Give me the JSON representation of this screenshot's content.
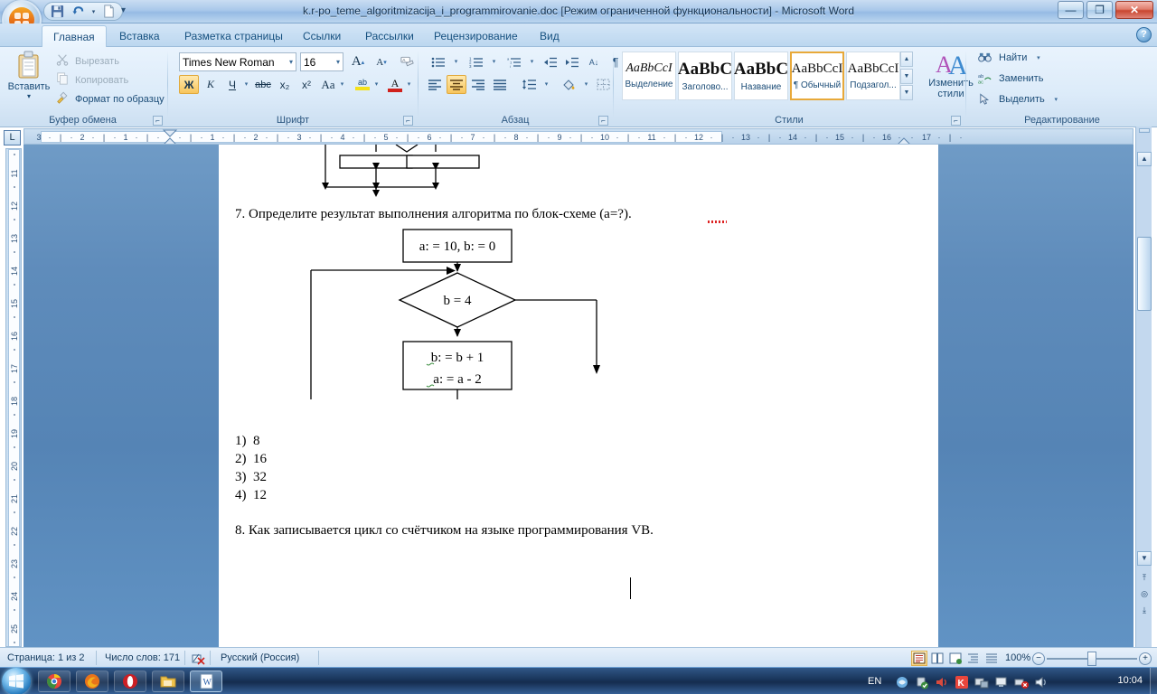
{
  "window": {
    "title": "k.r-po_teme_algoritmizacija_i_programmirovanie.doc [Режим ограниченной функциональности] - Microsoft Word",
    "minimize_label": "—",
    "maximize_label": "❐",
    "close_label": "✕"
  },
  "quick_access": {
    "save_label": "Сохранить",
    "undo_label": "Отменить",
    "undo_dropdown_label": "▾",
    "new_label": "Создать",
    "customize_label": "▾"
  },
  "tabs": [
    {
      "label": "Главная",
      "active": true
    },
    {
      "label": "Вставка",
      "active": false
    },
    {
      "label": "Разметка страницы",
      "active": false
    },
    {
      "label": "Ссылки",
      "active": false
    },
    {
      "label": "Рассылки",
      "active": false
    },
    {
      "label": "Рецензирование",
      "active": false
    },
    {
      "label": "Вид",
      "active": false
    }
  ],
  "help_label": "?",
  "ribbon": {
    "clipboard": {
      "group_label": "Буфер обмена",
      "paste_label": "Вставить",
      "paste_arrow": "▾",
      "cut_label": "Вырезать",
      "copy_label": "Копировать",
      "format_painter_label": "Формат по образцу",
      "launcher_label": "⌐"
    },
    "font": {
      "group_label": "Шрифт",
      "font_name": "Times New Roman",
      "font_size": "16",
      "grow_label": "A",
      "shrink_label": "A",
      "clear_format_label": "Aa",
      "bold_label": "Ж",
      "italic_label": "К",
      "underline_label": "Ч",
      "underline_arrow": "▾",
      "strike_label": "abc",
      "subscript_label": "x₂",
      "superscript_label": "x²",
      "case_label": "Aa",
      "case_arrow": "▾",
      "highlight_label": "ab",
      "highlight_arrow": "▾",
      "fontcolor_label": "A",
      "fontcolor_arrow": "▾",
      "launcher_label": "⌐"
    },
    "paragraph": {
      "group_label": "Абзац",
      "bullets_label": "☰",
      "numbering_label": "☰",
      "multilevel_label": "☰",
      "decrease_indent_label": "⇤",
      "increase_indent_label": "⇥",
      "sort_label": "A↓",
      "marks_label": "¶",
      "align_left_label": "☰",
      "align_center_label": "☰",
      "align_right_label": "☰",
      "justify_label": "☰",
      "linespacing_label": "↕",
      "shading_label": "▨",
      "borders_label": "▢",
      "launcher_label": "⌐"
    },
    "styles": {
      "group_label": "Стили",
      "items": [
        {
          "sample": "AaBbCcI",
          "name": "Выделение",
          "style": "italic-serif",
          "selected": false
        },
        {
          "sample": "AaBbC",
          "name": "Заголово...",
          "style": "bold-serif",
          "selected": false
        },
        {
          "sample": "AaBbC",
          "name": "Название",
          "style": "bold-serif",
          "selected": false
        },
        {
          "sample": "AaBbCcI",
          "name": "¶ Обычный",
          "style": "plain-serif",
          "selected": true
        },
        {
          "sample": "AaBbCcI",
          "name": "Подзагол...",
          "style": "plain-serif",
          "selected": false
        }
      ],
      "scroll_up_label": "▲",
      "scroll_down_label": "▼",
      "more_label": "▼",
      "change_styles_label_line1": "Изменить",
      "change_styles_label_line2": "стили",
      "change_styles_arrow": "▾",
      "launcher_label": "⌐"
    },
    "editing": {
      "group_label": "Редактирование",
      "find_label": "Найти",
      "find_arrow": "▾",
      "replace_label": "Заменить",
      "select_label": "Выделить",
      "select_arrow": "▾"
    }
  },
  "rulers": {
    "tab_stop_label": "L",
    "horizontal_numbers": [
      "3",
      "2",
      "1",
      "1",
      "2",
      "3",
      "4",
      "5",
      "6",
      "7",
      "8",
      "9",
      "10",
      "11",
      "12",
      "13",
      "14",
      "15",
      "16",
      "17"
    ],
    "vertical_numbers": [
      "11",
      "12",
      "13",
      "14",
      "15",
      "16",
      "17",
      "18",
      "19",
      "20",
      "21",
      "22",
      "23",
      "24",
      "25"
    ]
  },
  "document": {
    "question_7": "7. Определите результат выполнения алгоритма по блок-схеме (a=?).",
    "question_7_spell_word": "a=",
    "flowchart": {
      "init_box": "a: = 10, b: = 0",
      "decision": "b = 4",
      "process_line1": "b: = b + 1",
      "process_line2": "a: = a - 2"
    },
    "answers": [
      {
        "num": "1)",
        "value": "8"
      },
      {
        "num": "2)",
        "value": "16"
      },
      {
        "num": "3)",
        "value": "32"
      },
      {
        "num": "4)",
        "value": "12"
      }
    ],
    "question_8": "8. Как записывается цикл со счётчиком на языке программирования VB."
  },
  "status_bar": {
    "page_label": "Страница: 1 из 2",
    "words_label": "Число слов: 171",
    "proofing_icon": "spellcheck-error-icon",
    "language_label": "Русский (Россия)",
    "views": [
      {
        "name": "print-layout",
        "glyph": "▤",
        "active": true
      },
      {
        "name": "full-screen-reading",
        "glyph": "◫",
        "active": false
      },
      {
        "name": "web-layout",
        "glyph": "▣",
        "active": false
      },
      {
        "name": "outline",
        "glyph": "☱",
        "active": false
      },
      {
        "name": "draft",
        "glyph": "▤",
        "active": false
      }
    ],
    "zoom_label": "100%",
    "zoom_out_label": "−",
    "zoom_in_label": "+"
  },
  "taskbar": {
    "start_label": "Пуск",
    "apps": [
      {
        "name": "chrome",
        "glyph": "◉"
      },
      {
        "name": "firefox",
        "glyph": "◉"
      },
      {
        "name": "opera",
        "glyph": "O"
      },
      {
        "name": "explorer",
        "glyph": "🗂"
      },
      {
        "name": "word",
        "glyph": "W"
      }
    ],
    "language_label": "EN",
    "clock_label": "10:04"
  },
  "colors": {
    "accent": "#1b4c77",
    "ribbon_bg": "#dcebf9",
    "workspace_bg": "#5f8cbb",
    "selection_orange": "#e8a93a",
    "close_red": "#c8452f"
  }
}
